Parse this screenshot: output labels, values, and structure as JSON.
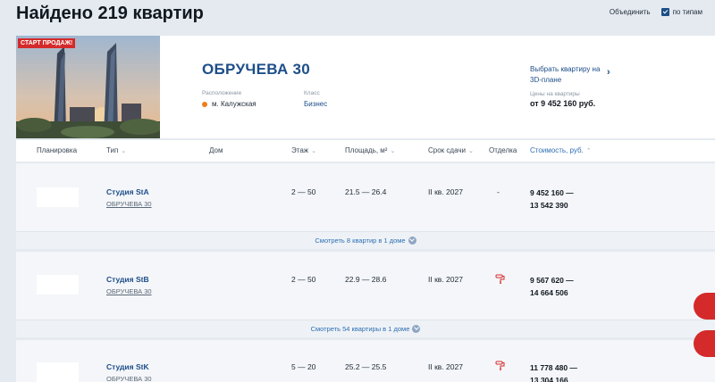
{
  "header": {
    "title": "Найдено 219 квартир",
    "group_label": "Объединить",
    "by_type_label": "по типам"
  },
  "project": {
    "badge": "СТАРТ ПРОДАЖ!",
    "name": "ОБРУЧЕВА 30",
    "location_label": "Расположение",
    "metro": "м. Калужская",
    "class_label": "Класс",
    "class_value": "Бизнес",
    "plan_3d": "Выбрать квартиру на 3D-плане",
    "plan_arrow": "›",
    "price_label": "Цены на квартиры",
    "price_value": "от 9 452 160 руб."
  },
  "columns": {
    "plan": "Планировка",
    "type": "Тип",
    "house": "Дом",
    "floor": "Этаж",
    "area": "Площадь, м²",
    "deadline": "Срок сдачи",
    "finish": "Отделка",
    "price": "Стоимость, руб.",
    "sort_icon": "chevron-down-icon"
  },
  "rows": [
    {
      "type": "Студия StA",
      "house": "ОБРУЧЕВА 30",
      "floor": "2 — 50",
      "area": "21.5  — 26.4",
      "deadline": "II кв. 2027",
      "finish": "-",
      "price_from": "9 452 160  —",
      "price_to": "13 542 390",
      "more": "Смотреть 8 квартир в 1 доме"
    },
    {
      "type": "Студия StB",
      "house": "ОБРУЧЕВА 30",
      "floor": "2 — 50",
      "area": "22.9  — 28.6",
      "deadline": "II кв. 2027",
      "finish_icon": "paint-roller-icon",
      "price_from": "9 567 620  —",
      "price_to": "14 664 506",
      "more": "Смотреть 54 квартиры в 1 доме"
    },
    {
      "type": "Студия StK",
      "house": "ОБРУЧЕВА 30",
      "floor": "5 — 20",
      "area": "25.2  — 25.5",
      "deadline": "II кв. 2027",
      "finish_icon": "paint-roller-icon",
      "price_from": "11 778 480  —",
      "price_to": "13 304 166"
    }
  ],
  "colors": {
    "accent": "#1d4e89",
    "badge": "#d42a2a",
    "metro": "#ef7d1a",
    "background": "#e4eaf0"
  }
}
